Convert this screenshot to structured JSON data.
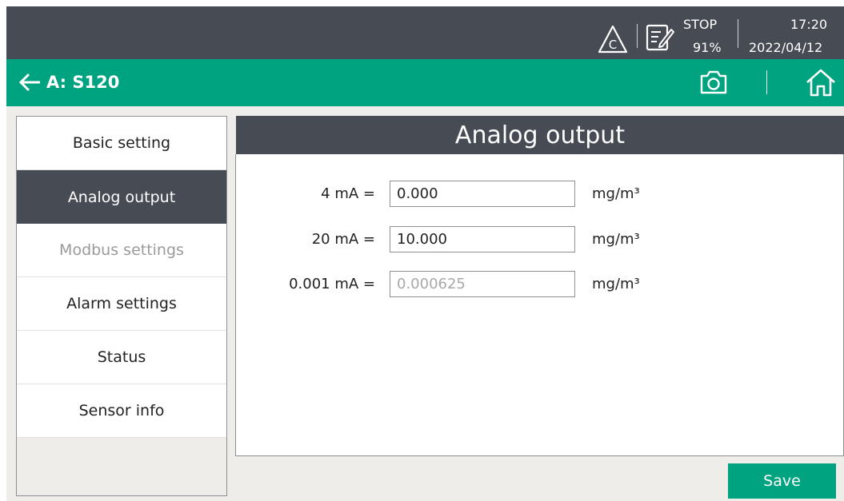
{
  "status_bar": {
    "warning_icon": "warning-c-icon",
    "note_icon": "edit-note-icon",
    "state": "STOP",
    "battery": "91%",
    "time": "17:20",
    "date": "2022/04/12"
  },
  "title_bar": {
    "back_icon": "arrow-left-icon",
    "title": "A: S120",
    "camera_icon": "camera-icon",
    "home_icon": "home-icon"
  },
  "sidebar": {
    "items": [
      {
        "label": "Basic setting",
        "state": "normal"
      },
      {
        "label": "Analog output",
        "state": "active"
      },
      {
        "label": "Modbus settings",
        "state": "disabled"
      },
      {
        "label": "Alarm settings",
        "state": "normal"
      },
      {
        "label": "Status",
        "state": "normal"
      },
      {
        "label": "Sensor info",
        "state": "normal"
      }
    ]
  },
  "panel": {
    "title": "Analog output",
    "rows": [
      {
        "label": "4 mA =",
        "value": "0.000",
        "unit": "mg/m³",
        "editable": true
      },
      {
        "label": "20 mA =",
        "value": "10.000",
        "unit": "mg/m³",
        "editable": true
      },
      {
        "label": "0.001 mA =",
        "value": "0.000625",
        "unit": "mg/m³",
        "editable": false
      }
    ]
  },
  "actions": {
    "save_label": "Save"
  },
  "colors": {
    "header_dark": "#474b54",
    "accent_green": "#00a37f",
    "background": "#efedea",
    "disabled_text": "#9a9a9a"
  }
}
